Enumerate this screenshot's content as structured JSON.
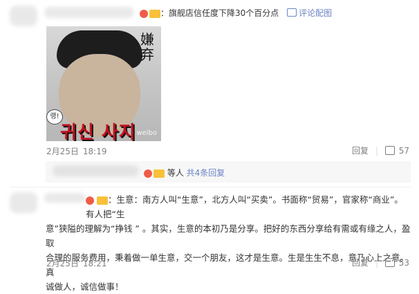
{
  "comment1": {
    "text": "：旗舰店信任度下降30个百分点",
    "reply_link": "评论配图",
    "sticker_side_text": "嫌弃",
    "sticker_red_text": "귀신 사지",
    "sticker_bubble": "랭!",
    "sticker_watermark": "weibo",
    "date": "2月25日",
    "time": "18:19",
    "reply_label": "回复",
    "likes": "57"
  },
  "replies_summary": {
    "others": "等人",
    "count_link": "共4条回复"
  },
  "comment2": {
    "lines": [
      "：生意：南方人叫“生意”，北方人叫“买卖”。书面称“贸易”，官家称“商业”。有人把“生",
      "意”狭隘的理解为“挣钱 ” 。其实，生意的本初乃是分享。把好的东西分享给有需或有缘之人，盈取",
      "合理的服务费用，秉着做一单生意，交一个朋友，这才是生意。生是生生不息，意乃心上之意。真",
      "诚做人，诚信做事！"
    ],
    "date": "2月25日",
    "time": "18:21",
    "reply_label": "回复",
    "likes": "53"
  }
}
